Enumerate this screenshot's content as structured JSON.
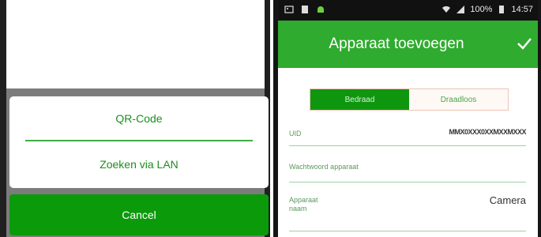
{
  "left_screen": {
    "dialog": {
      "option_qr": "QR-Code",
      "option_lan": "Zoeken via LAN"
    },
    "cancel_label": "Cancel"
  },
  "right_screen": {
    "status_bar": {
      "battery": "100%",
      "time": "14:57"
    },
    "app_bar": {
      "title": "Apparaat toevoegen",
      "confirm_icon": "check-icon"
    },
    "connection_tabs": {
      "wired": "Bedraad",
      "wireless": "Draadloos"
    },
    "fields": {
      "uid_label": "UID",
      "uid_value": "MMX0XXX0XXMXXMXXX",
      "password_label": "Wachtwoord apparaat",
      "name_label": "Apparaat naam",
      "name_value": "Camera"
    }
  },
  "colors": {
    "primary_green": "#2fab2f",
    "dark_green": "#0a9a0a",
    "dim_overlay": "#7c7c7c"
  }
}
